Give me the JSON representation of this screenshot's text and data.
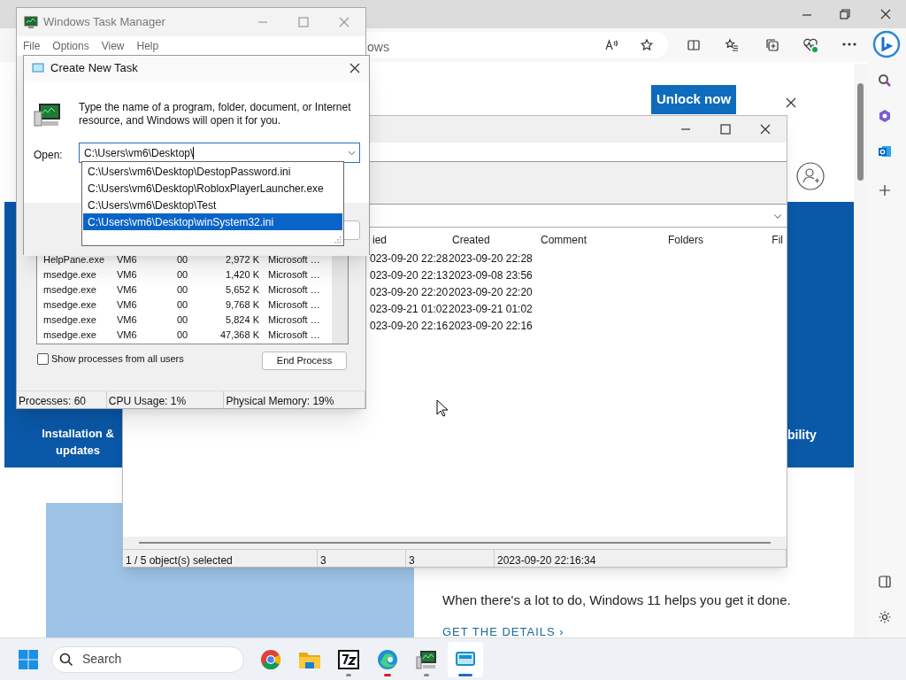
{
  "browser": {
    "address_fragment": "ows",
    "promo_button": "Unlock now",
    "banner_tiles": [
      {
        "label": "Installation & updates"
      },
      {
        "label": "bility"
      }
    ],
    "promo_text": "When there's a lot to do, Windows 11 helps you get it done.",
    "promo_link": "GET THE DETAILS ›"
  },
  "file_manager": {
    "columns": [
      "ied",
      "Created",
      "Comment",
      "Folders",
      "Fil"
    ],
    "rows": [
      {
        "modified": "023-09-20 22:28",
        "created": "2023-09-20 22:28"
      },
      {
        "modified": "023-09-20 22:13",
        "created": "2023-09-08 23:56"
      },
      {
        "modified": "023-09-20 22:20",
        "created": "2023-09-20 22:20"
      },
      {
        "modified": "023-09-21 01:02",
        "created": "2023-09-21 01:02"
      },
      {
        "modified": "023-09-20 22:16",
        "created": "2023-09-20 22:16"
      }
    ],
    "status_bar": [
      "1 / 5 object(s) selected",
      "3",
      "3",
      "2023-09-20 22:16:34"
    ]
  },
  "task_manager": {
    "title": "Windows Task Manager",
    "menu": [
      "File",
      "Options",
      "View",
      "Help"
    ],
    "processes": [
      {
        "name": "HelpPane.exe",
        "user": "VM6",
        "cpu": "00",
        "memory": "2,972 K",
        "description": "Microsoft …"
      },
      {
        "name": "msedge.exe",
        "user": "VM6",
        "cpu": "00",
        "memory": "1,420 K",
        "description": "Microsoft …"
      },
      {
        "name": "msedge.exe",
        "user": "VM6",
        "cpu": "00",
        "memory": "5,652 K",
        "description": "Microsoft …"
      },
      {
        "name": "msedge.exe",
        "user": "VM6",
        "cpu": "00",
        "memory": "9,768 K",
        "description": "Microsoft …"
      },
      {
        "name": "msedge.exe",
        "user": "VM6",
        "cpu": "00",
        "memory": "5,824 K",
        "description": "Microsoft …"
      },
      {
        "name": "msedge.exe",
        "user": "VM6",
        "cpu": "00",
        "memory": "47,368 K",
        "description": "Microsoft …"
      }
    ],
    "show_all_users": {
      "label": "Show processes from all users",
      "checked": false
    },
    "end_process": "End Process",
    "status_bar": [
      "Processes: 60",
      "CPU Usage: 1%",
      "Physical Memory: 19%"
    ]
  },
  "create_task": {
    "title": "Create New Task",
    "description": "Type the name of a program, folder, document, or Internet resource, and Windows will open it for you.",
    "open_label": "Open:",
    "value": "C:\\Users\\vm6\\Desktop\\",
    "suggestions": [
      {
        "text": "C:\\Users\\vm6\\Desktop\\DestopPassword.ini",
        "selected": false
      },
      {
        "text": "C:\\Users\\vm6\\Desktop\\RobloxPlayerLauncher.exe",
        "selected": false
      },
      {
        "text": "C:\\Users\\vm6\\Desktop\\Test",
        "selected": false
      },
      {
        "text": "C:\\Users\\vm6\\Desktop\\winSystem32.ini",
        "selected": true
      }
    ]
  },
  "taskbar": {
    "search_placeholder": "Search",
    "apps": [
      {
        "kind": "chrome",
        "running": false,
        "alert": false,
        "selected": false
      },
      {
        "kind": "folder",
        "running": false,
        "alert": false,
        "selected": false
      },
      {
        "kind": "archive",
        "running": true,
        "alert": false,
        "selected": false
      },
      {
        "kind": "edge",
        "running": true,
        "alert": true,
        "selected": false
      },
      {
        "kind": "taskmgr",
        "running": true,
        "alert": false,
        "selected": false
      },
      {
        "kind": "window",
        "running": true,
        "alert": false,
        "selected": true
      }
    ]
  }
}
